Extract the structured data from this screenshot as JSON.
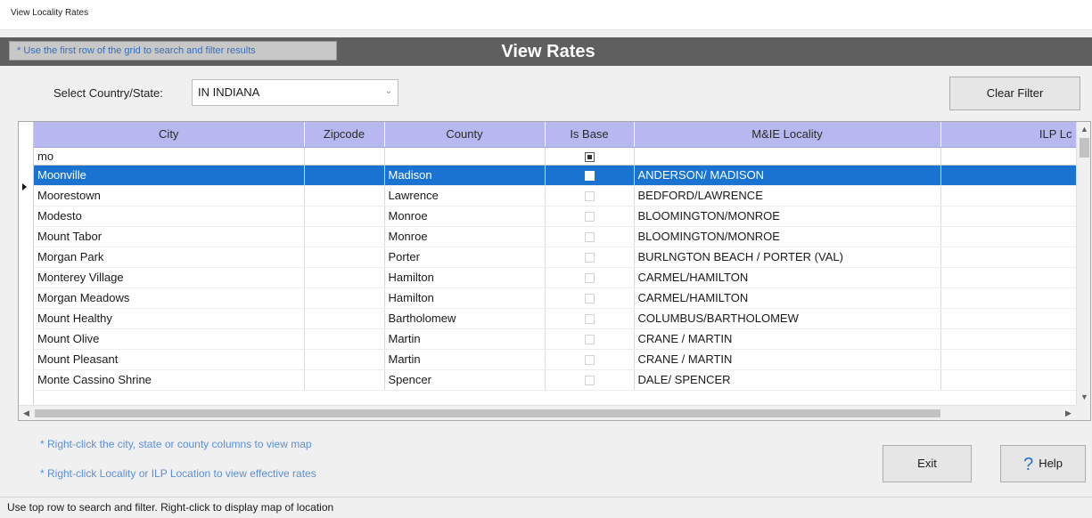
{
  "window": {
    "title": "View Locality Rates"
  },
  "header": {
    "hint": "* Use the first row of the grid to search and filter results",
    "title": "View Rates"
  },
  "country_select": {
    "label": "Select Country/State:",
    "value": "IN INDIANA"
  },
  "buttons": {
    "clear_filter": "Clear Filter",
    "exit": "Exit",
    "help": "Help"
  },
  "grid": {
    "columns": [
      "City",
      "Zipcode",
      "County",
      "Is Base",
      "M&IE Locality",
      "ILP Lc"
    ],
    "filter": {
      "city": "mo",
      "zipcode": "",
      "county": "",
      "is_base": "indeterminate",
      "mie": "",
      "ilp": ""
    },
    "rows": [
      {
        "city": "Moonville",
        "zipcode": "",
        "county": "Madison",
        "is_base": false,
        "mie": "ANDERSON/ MADISON",
        "ilp": "",
        "selected": true
      },
      {
        "city": "Moorestown",
        "zipcode": "",
        "county": "Lawrence",
        "is_base": false,
        "mie": "BEDFORD/LAWRENCE",
        "ilp": ""
      },
      {
        "city": "Modesto",
        "zipcode": "",
        "county": "Monroe",
        "is_base": false,
        "mie": "BLOOMINGTON/MONROE",
        "ilp": ""
      },
      {
        "city": "Mount Tabor",
        "zipcode": "",
        "county": "Monroe",
        "is_base": false,
        "mie": "BLOOMINGTON/MONROE",
        "ilp": ""
      },
      {
        "city": "Morgan Park",
        "zipcode": "",
        "county": "Porter",
        "is_base": false,
        "mie": "BURLNGTON BEACH / PORTER  (VAL)",
        "ilp": ""
      },
      {
        "city": "Monterey Village",
        "zipcode": "",
        "county": "Hamilton",
        "is_base": false,
        "mie": "CARMEL/HAMILTON",
        "ilp": ""
      },
      {
        "city": "Morgan Meadows",
        "zipcode": "",
        "county": "Hamilton",
        "is_base": false,
        "mie": "CARMEL/HAMILTON",
        "ilp": ""
      },
      {
        "city": "Mount Healthy",
        "zipcode": "",
        "county": "Bartholomew",
        "is_base": false,
        "mie": "COLUMBUS/BARTHOLOMEW",
        "ilp": ""
      },
      {
        "city": "Mount Olive",
        "zipcode": "",
        "county": "Martin",
        "is_base": false,
        "mie": "CRANE / MARTIN",
        "ilp": ""
      },
      {
        "city": "Mount Pleasant",
        "zipcode": "",
        "county": "Martin",
        "is_base": false,
        "mie": "CRANE / MARTIN",
        "ilp": ""
      },
      {
        "city": "Monte Cassino Shrine",
        "zipcode": "",
        "county": "Spencer",
        "is_base": false,
        "mie": "DALE/ SPENCER",
        "ilp": ""
      }
    ]
  },
  "notes": {
    "map": "* Right-click the city, state or county columns to view map",
    "rates": "* Right-click Locality or ILP Location to view effective rates"
  },
  "status": {
    "text": "Use top row to search and filter. Right-click to display map of location"
  },
  "colors": {
    "header_band": "#5f5f5f",
    "column_header": "#b8b8f0",
    "selection": "#1a73d0",
    "note_text": "#5b8fd6"
  }
}
